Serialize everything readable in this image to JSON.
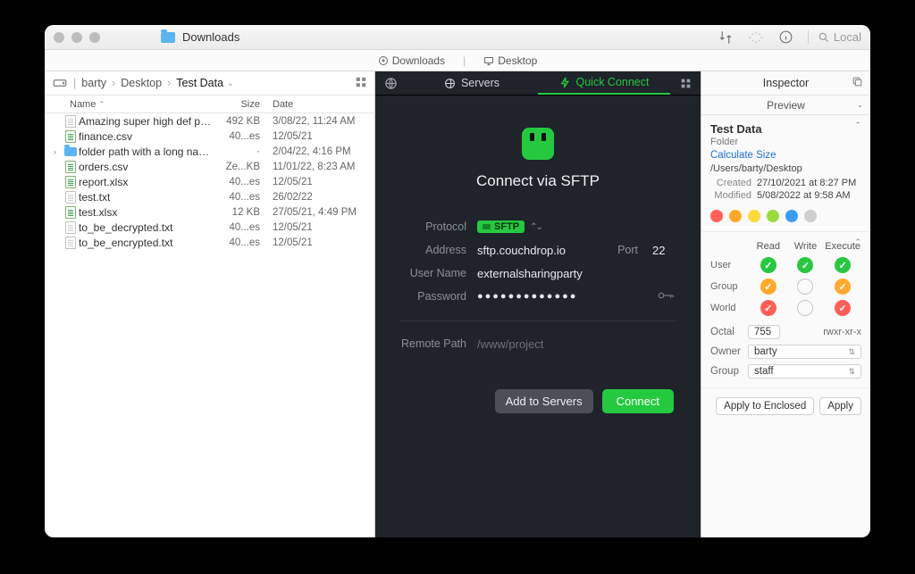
{
  "window": {
    "title": "Downloads"
  },
  "toolbar": {
    "search_placeholder": "Local"
  },
  "locations": {
    "left": "Downloads",
    "right": "Desktop"
  },
  "breadcrumbs": {
    "a": "barty",
    "b": "Desktop",
    "current": "Test Data"
  },
  "columns": {
    "name": "Name",
    "size": "Size",
    "date": "Date"
  },
  "files": [
    {
      "icon": "txt",
      "name": "Amazing super high def photo....",
      "size": "492 KB",
      "date": "3/08/22, 11:24 AM"
    },
    {
      "icon": "green",
      "name": "finance.csv",
      "size": "40...es",
      "date": "12/05/21"
    },
    {
      "icon": "folder",
      "name": "folder path with a long name hh...",
      "size": "·",
      "date": "2/04/22, 4:16 PM",
      "expandable": true
    },
    {
      "icon": "green",
      "name": "orders.csv",
      "size": "Ze...KB",
      "date": "11/01/22, 8:23 AM"
    },
    {
      "icon": "green",
      "name": "report.xlsx",
      "size": "40...es",
      "date": "12/05/21"
    },
    {
      "icon": "txt",
      "name": "test.txt",
      "size": "40...es",
      "date": "26/02/22"
    },
    {
      "icon": "green",
      "name": "test.xlsx",
      "size": "12 KB",
      "date": "27/05/21, 4:49 PM"
    },
    {
      "icon": "txt",
      "name": "to_be_decrypted.txt",
      "size": "40...es",
      "date": "12/05/21"
    },
    {
      "icon": "txt",
      "name": "to_be_encrypted.txt",
      "size": "40...es",
      "date": "12/05/21"
    }
  ],
  "center": {
    "tab_servers": "Servers",
    "tab_quick": "Quick Connect",
    "title": "Connect via SFTP",
    "labels": {
      "protocol": "Protocol",
      "address": "Address",
      "port": "Port",
      "username": "User Name",
      "password": "Password",
      "remote": "Remote Path"
    },
    "protocol": "SFTP",
    "address": "sftp.couchdrop.io",
    "port": "22",
    "username": "externalsharingparty",
    "password_dots": "●●●●●●●●●●●●●",
    "remote_placeholder": "/www/project",
    "btn_add": "Add to Servers",
    "btn_connect": "Connect"
  },
  "inspector": {
    "title": "Inspector",
    "preview": "Preview",
    "name": "Test Data",
    "kind": "Folder",
    "calc": "Calculate Size",
    "path": "/Users/barty/Desktop",
    "created_label": "Created",
    "created": "27/10/2021 at 8:27 PM",
    "modified_label": "Modified",
    "modified": "5/08/2022 at 9:58 AM",
    "tags": [
      "#ff5f57",
      "#ffaa2c",
      "#ffd838",
      "#9adb3e",
      "#3b9cf2",
      "#cfcfcf"
    ],
    "perm_headers": {
      "read": "Read",
      "write": "Write",
      "execute": "Execute"
    },
    "perm_rows": {
      "user": "User",
      "group": "Group",
      "world": "World"
    },
    "perm_colors": {
      "user": {
        "read": "#27c840",
        "write": "#27c840",
        "execute": "#27c840"
      },
      "group": {
        "read": "#ffaa2c",
        "write": "off",
        "execute": "#ffaa2c"
      },
      "world": {
        "read": "#ff5f57",
        "write": "off",
        "execute": "#ff5f57"
      }
    },
    "octal_label": "Octal",
    "octal": "755",
    "octal_str": "rwxr-xr-x",
    "owner_label": "Owner",
    "owner": "barty",
    "group_label": "Group",
    "group": "staff",
    "apply_enclosed": "Apply to Enclosed",
    "apply": "Apply"
  }
}
